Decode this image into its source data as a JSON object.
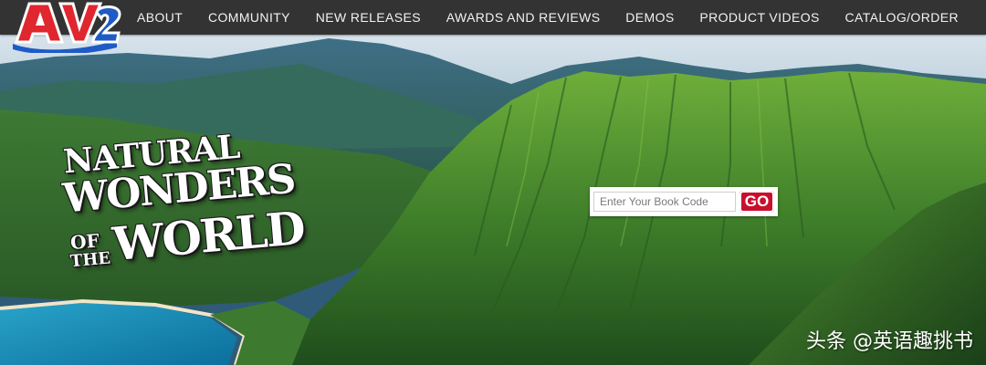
{
  "logo": {
    "text": "AV2",
    "colors": {
      "blue": "#1e5bc6",
      "red": "#e0262e",
      "white": "#ffffff"
    }
  },
  "nav": {
    "items": [
      {
        "label": "ABOUT"
      },
      {
        "label": "COMMUNITY"
      },
      {
        "label": "NEW RELEASES"
      },
      {
        "label": "AWARDS AND REVIEWS"
      },
      {
        "label": "DEMOS"
      },
      {
        "label": "PRODUCT VIDEOS"
      },
      {
        "label": "CATALOG/ORDER"
      }
    ]
  },
  "hero": {
    "title_lines": {
      "natural": "NATURAL",
      "wonders": "WONDERS",
      "of": "OF",
      "the": "THE",
      "world": "WORLD"
    }
  },
  "book_code": {
    "placeholder": "Enter Your Book Code",
    "go_label": "GO",
    "accent_color": "#c8102e"
  },
  "watermark": {
    "text": "头条 @英语趣挑书"
  },
  "colors": {
    "navbar": "#333333",
    "nav_text": "#f2f2f2"
  }
}
